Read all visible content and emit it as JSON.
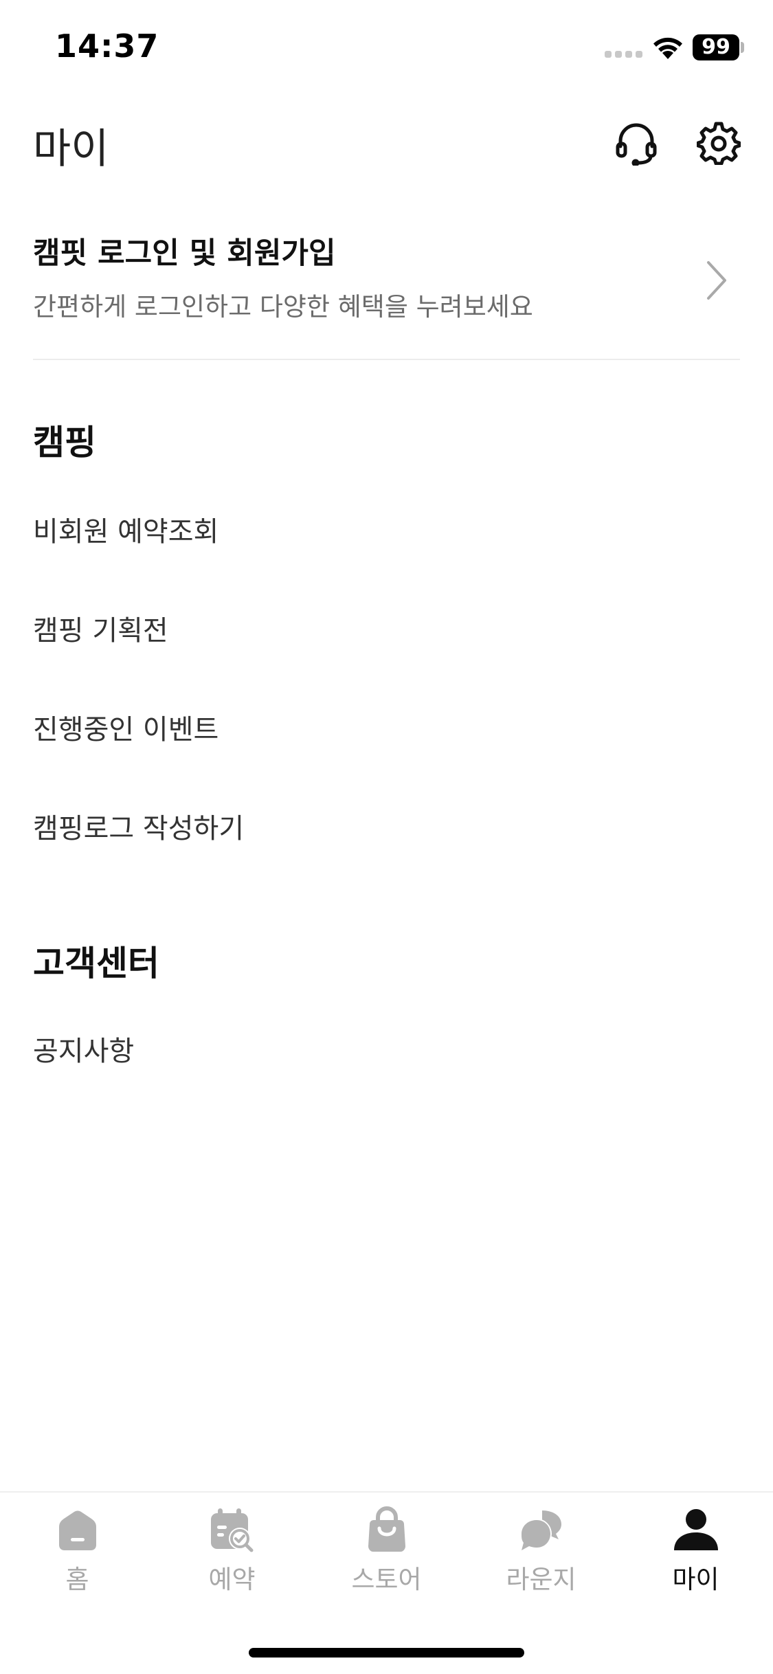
{
  "status": {
    "time": "14:37",
    "battery": "99"
  },
  "header": {
    "title": "마이",
    "support_icon": "headset-icon",
    "settings_icon": "gear-icon"
  },
  "login": {
    "title": "캠핏 로그인 및 회원가입",
    "subtitle": "간편하게 로그인하고 다양한 혜택을 누려보세요"
  },
  "sections": {
    "camping": {
      "title": "캠핑",
      "items": [
        "비회원 예약조회",
        "캠핑 기획전",
        "진행중인 이벤트",
        "캠핑로그 작성하기"
      ]
    },
    "support": {
      "title": "고객센터",
      "items": [
        "공지사항"
      ]
    }
  },
  "tabs": [
    {
      "label": "홈",
      "icon": "home-icon"
    },
    {
      "label": "예약",
      "icon": "calendar-check-icon"
    },
    {
      "label": "스토어",
      "icon": "shopping-bag-icon"
    },
    {
      "label": "라운지",
      "icon": "chat-bubbles-icon"
    },
    {
      "label": "마이",
      "icon": "person-icon",
      "active": true
    }
  ],
  "colors": {
    "active": "#111111",
    "inactive": "#a8a8a8",
    "icon_inactive": "#b3b3b3"
  }
}
